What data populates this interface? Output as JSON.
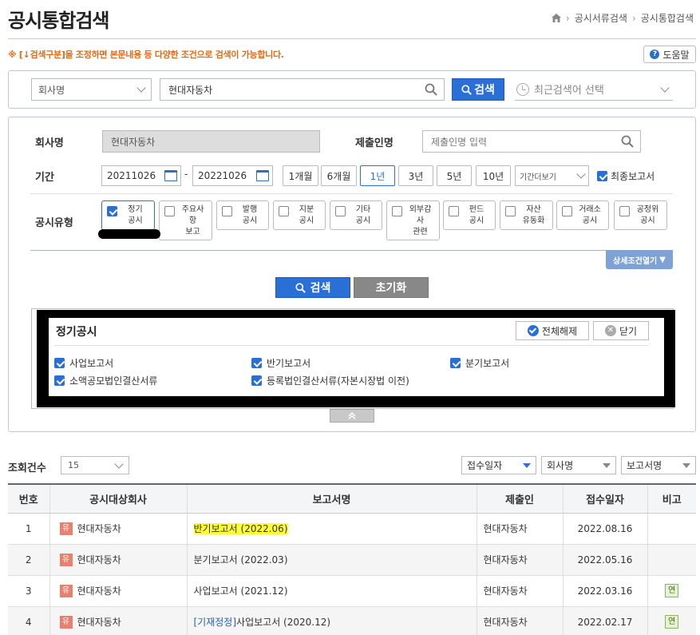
{
  "header": {
    "title": "공시통합검색",
    "breadcrumb": [
      "공시서류검색",
      "공시통합검색"
    ]
  },
  "notice": "※ [↓검색구분]을 조정하면 본문내용 등 다양한 조건으로 검색이 가능합니다.",
  "help_label": "도움말",
  "top_search": {
    "category": "회사명",
    "keyword": "현대자동차",
    "search_label": "검색",
    "recent_placeholder": "최근검색어 선택"
  },
  "filters": {
    "company_label": "회사명",
    "company_value": "현대자동차",
    "submitter_label": "제출인명",
    "submitter_placeholder": "제출인명 입력",
    "period_label": "기간",
    "date_from": "20211026",
    "date_to": "20221026",
    "date_dash": "-",
    "period_buttons": [
      "1개월",
      "6개월",
      "1년",
      "3년",
      "5년",
      "10년"
    ],
    "period_active": "1년",
    "period_more": "기간더보기",
    "final_report_label": "최종보고서",
    "disclosure_label": "공시유형",
    "disclosure_types": [
      {
        "label": "정기\n공시",
        "checked": true
      },
      {
        "label": "주요사\n항\n보고",
        "checked": false
      },
      {
        "label": "발행\n공시",
        "checked": false
      },
      {
        "label": "지분\n공시",
        "checked": false
      },
      {
        "label": "기타\n공시",
        "checked": false
      },
      {
        "label": "외부감\n사\n관련",
        "checked": false
      },
      {
        "label": "펀드\n공시",
        "checked": false
      },
      {
        "label": "자산\n유동화",
        "checked": false
      },
      {
        "label": "거래소\n공시",
        "checked": false
      },
      {
        "label": "공정위\n공시",
        "checked": false
      }
    ],
    "detail_toggle": "상세조건열기",
    "search_label": "검색",
    "reset_label": "초기화"
  },
  "sub_panel": {
    "title": "정기공시",
    "deselect_all": "전체해제",
    "close": "닫기",
    "items": [
      {
        "label": "사업보고서",
        "checked": true
      },
      {
        "label": "반기보고서",
        "checked": true
      },
      {
        "label": "분기보고서",
        "checked": true
      },
      {
        "label": "소액공모법인결산서류",
        "checked": true
      },
      {
        "label": "등록법인결산서류(자본시장법 이전)",
        "checked": true
      }
    ],
    "collapse_icon": "double-chevron-up-icon"
  },
  "results": {
    "count_label": "조회건수",
    "count_value": "15",
    "sort_options": [
      "접수일자",
      "회사명",
      "보고서명"
    ],
    "columns": [
      "번호",
      "공시대상회사",
      "보고서명",
      "제출인",
      "접수일자",
      "비고"
    ],
    "rows": [
      {
        "no": "1",
        "badge": "유",
        "company": "현대자동차",
        "prefix": "",
        "report": "반기보고서 (2022.06)",
        "submitter": "현대자동차",
        "date": "2022.08.16",
        "note": ""
      },
      {
        "no": "2",
        "badge": "유",
        "company": "현대자동차",
        "prefix": "",
        "report": "분기보고서 (2022.03)",
        "submitter": "현대자동차",
        "date": "2022.05.16",
        "note": ""
      },
      {
        "no": "3",
        "badge": "유",
        "company": "현대자동차",
        "prefix": "",
        "report": "사업보고서 (2021.12)",
        "submitter": "현대자동차",
        "date": "2022.03.16",
        "note": "연"
      },
      {
        "no": "4",
        "badge": "유",
        "company": "현대자동차",
        "prefix": "[기재정정]",
        "report": "사업보고서 (2020.12)",
        "submitter": "현대자동차",
        "date": "2022.02.17",
        "note": "연"
      }
    ]
  }
}
